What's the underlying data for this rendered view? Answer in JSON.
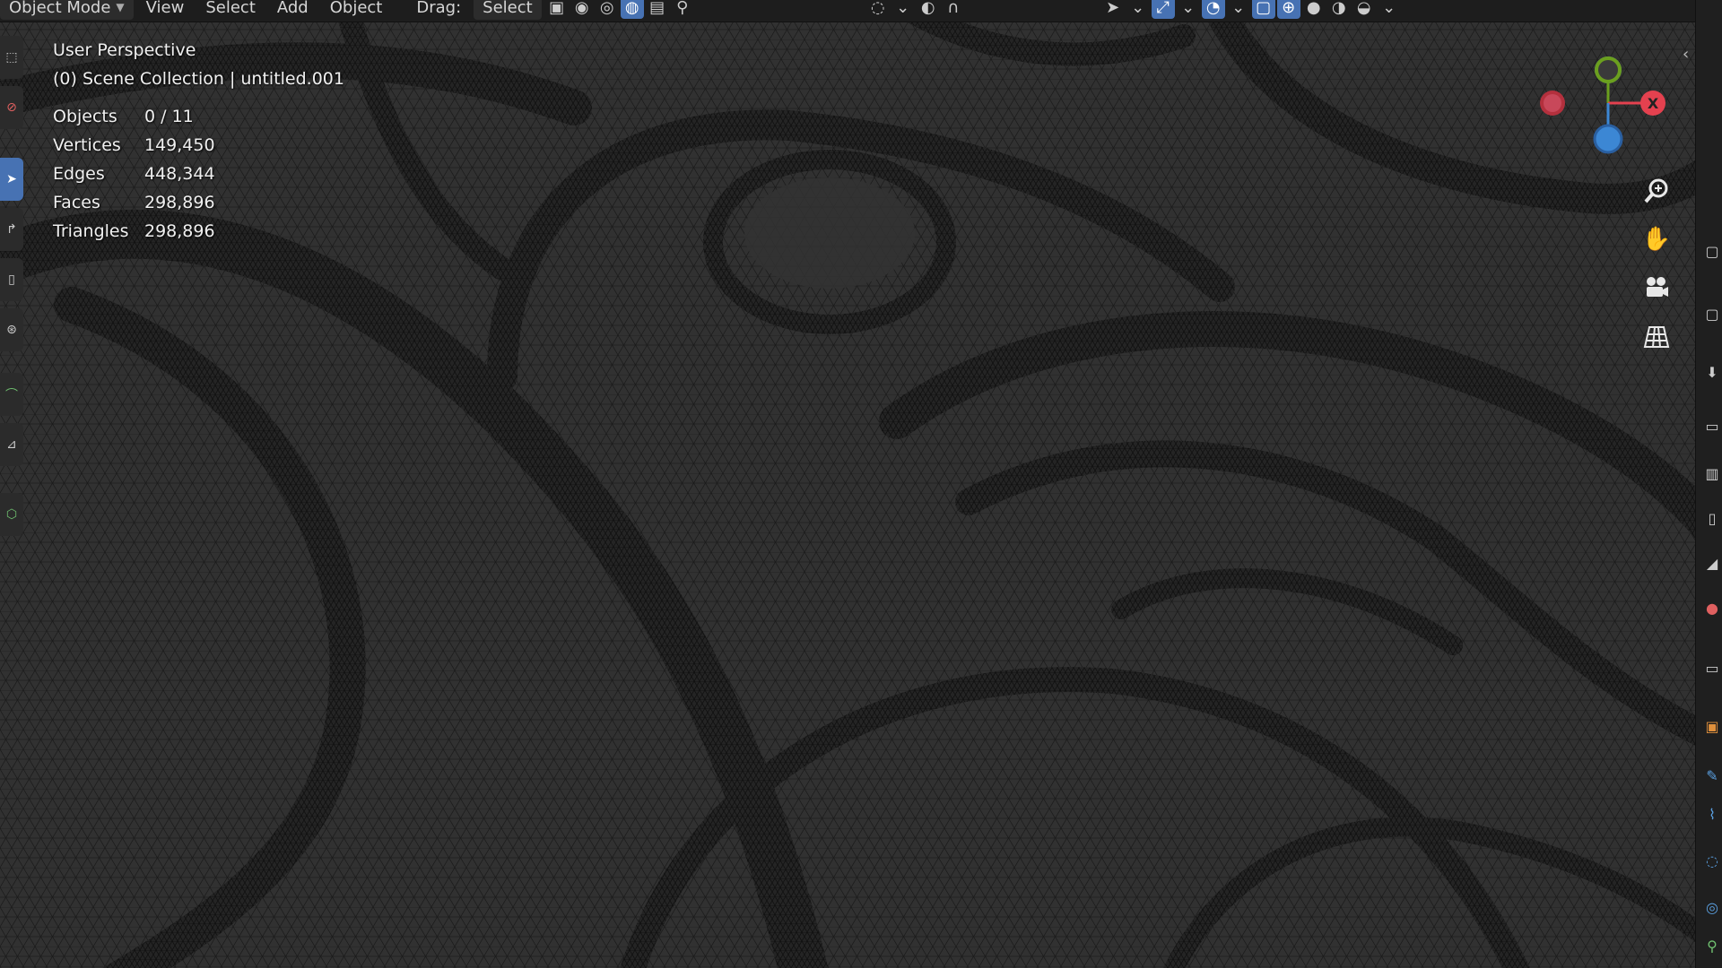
{
  "header": {
    "mode_label": "Object Mode",
    "menu": [
      "View",
      "Select",
      "Add",
      "Object"
    ],
    "drag_label": "Drag:",
    "select_label": "Select"
  },
  "overlay": {
    "view_name": "User Perspective",
    "collection": "(0) Scene Collection | untitled.001",
    "stats": [
      {
        "label": "Objects",
        "value": "0 / 11"
      },
      {
        "label": "Vertices",
        "value": "149,450"
      },
      {
        "label": "Edges",
        "value": "448,344"
      },
      {
        "label": "Faces",
        "value": "298,896"
      },
      {
        "label": "Triangles",
        "value": "298,896"
      }
    ]
  },
  "gizmo": {
    "x_label": "X",
    "colors": {
      "x": "#e4414f",
      "y": "#6b9f1e",
      "z": "#3c87d4",
      "neg_x": "#b3303d"
    }
  },
  "colors": {
    "viewport_bg": "#303030",
    "wire": "#141414",
    "accent": "#4772b3"
  },
  "icons": {
    "zoom": "zoom-icon",
    "pan": "hand-icon",
    "camera": "camera-icon",
    "grid": "ortho-grid-icon"
  }
}
